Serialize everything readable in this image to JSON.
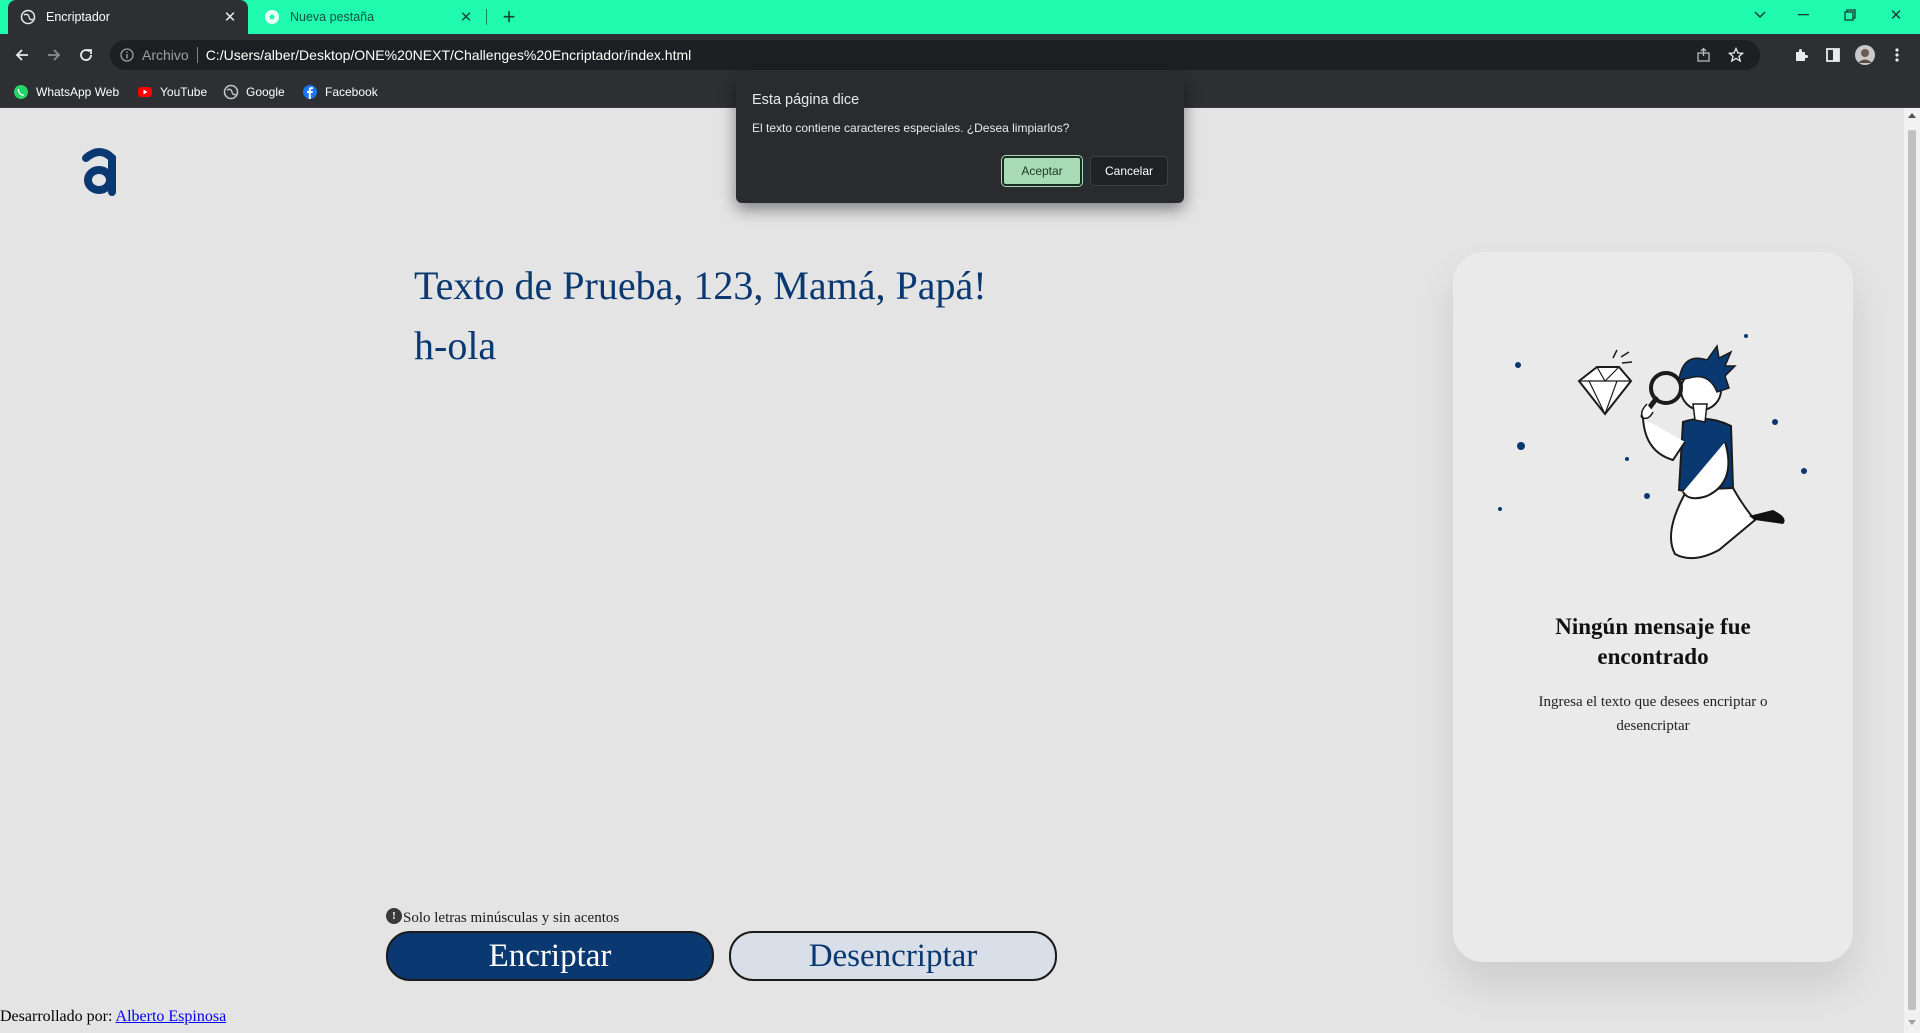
{
  "browser": {
    "tabs": [
      {
        "title": "Encriptador",
        "active": true
      },
      {
        "title": "Nueva pestaña",
        "active": false
      }
    ],
    "address": {
      "scheme_label": "Archivo",
      "url": "C:/Users/alber/Desktop/ONE%20NEXT/Challenges%20Encriptador/index.html"
    },
    "bookmarks": [
      {
        "label": "WhatsApp Web",
        "icon": "whatsapp-icon"
      },
      {
        "label": "YouTube",
        "icon": "youtube-icon"
      },
      {
        "label": "Google",
        "icon": "globe-icon"
      },
      {
        "label": "Facebook",
        "icon": "facebook-icon"
      }
    ],
    "colors": {
      "tabstrip": "#1ffaaf",
      "toolbar": "#2d2f33"
    }
  },
  "dialog": {
    "title": "Esta página dice",
    "message": "El texto contiene caracteres especiales. ¿Desea limpiarlos?",
    "ok_label": "Aceptar",
    "cancel_label": "Cancelar"
  },
  "page": {
    "input_text": "Texto de Prueba, 123, Mamá, Papá!\nh-ola",
    "hint": "Solo letras minúsculas y sin acentos",
    "hint_icon": "!",
    "encrypt_label": "Encriptar",
    "decrypt_label": "Desencriptar",
    "footer_prefix": "Desarrollado por: ",
    "footer_author": "Alberto Espinosa",
    "colors": {
      "primary": "#0a3871",
      "background": "#e4e4e4"
    }
  },
  "output_card": {
    "title": "Ningún mensaje fue encontrado",
    "description": "Ingresa el texto que desees encriptar o desencriptar"
  }
}
